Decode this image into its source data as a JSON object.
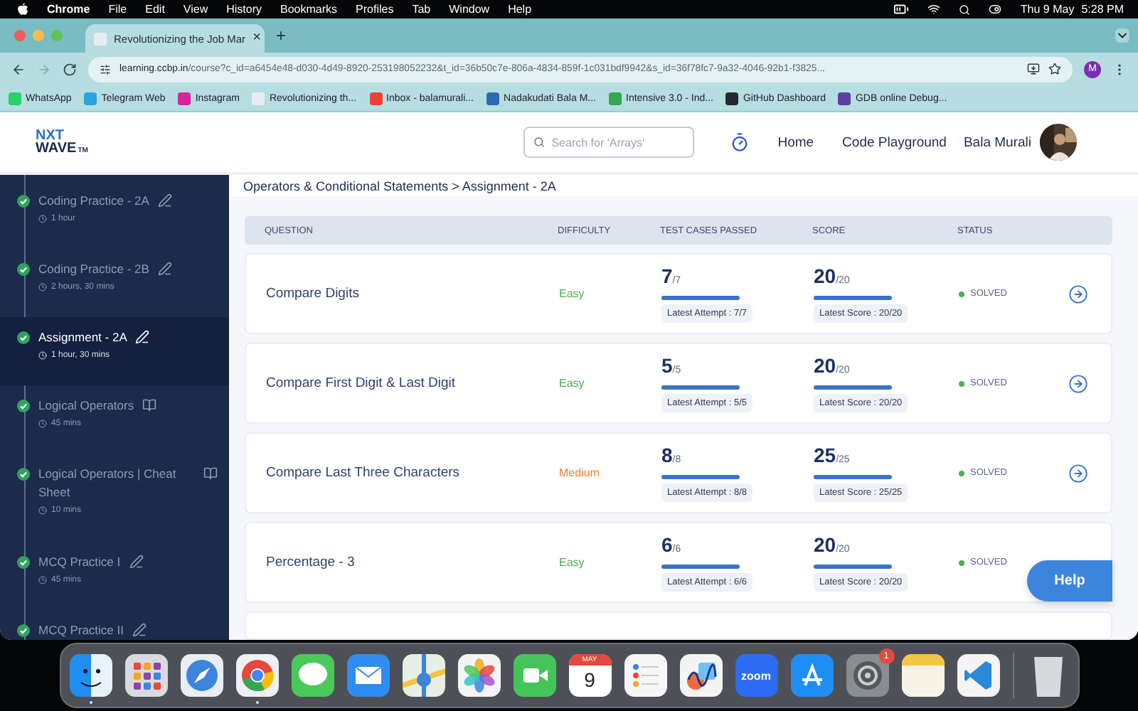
{
  "menu_bar": {
    "app": "Chrome",
    "items": [
      "File",
      "Edit",
      "View",
      "History",
      "Bookmarks",
      "Profiles",
      "Tab",
      "Window",
      "Help"
    ],
    "date": "Thu 9 May",
    "time": "5:28 PM"
  },
  "browser": {
    "tab": {
      "title": "Revolutionizing the Job Mar",
      "close": "×"
    },
    "new_tab": "+",
    "url": {
      "host": "learning.ccbp.in",
      "path": "/course?c_id=a6454e48-d030-4d49-8920-253198052232&t_id=36b50c7e-806a-4834-859f-1c031bdf9942&s_id=36f78fc7-9a32-4046-92b1-f3825..."
    },
    "profile": "M",
    "bookmarks": [
      {
        "label": "WhatsApp",
        "color": "#25d366"
      },
      {
        "label": "Telegram Web",
        "color": "#2aa3df"
      },
      {
        "label": "Instagram",
        "color": "#d6249f"
      },
      {
        "label": "Revolutionizing th...",
        "color": "#e8ecf2"
      },
      {
        "label": "Inbox - balamurali...",
        "color": "#ea4335"
      },
      {
        "label": "Nadakudati Bala M...",
        "color": "#2d6ab4"
      },
      {
        "label": "Intensive 3.0 - Ind...",
        "color": "#34a853"
      },
      {
        "label": "GitHub Dashboard",
        "color": "#24292e"
      },
      {
        "label": "GDB online Debug...",
        "color": "#5b3fa3"
      }
    ]
  },
  "header": {
    "logo": {
      "top": "NXT",
      "bottom": "WAVE",
      "mark": "TM"
    },
    "search": {
      "placeholder": "Search for 'Arrays'"
    },
    "nav": [
      "Home",
      "Code Playground"
    ],
    "user": "Bala Murali"
  },
  "sidebar": {
    "items": [
      {
        "title": "Coding Practice - 2A",
        "duration": "1 hour",
        "kind": "edit",
        "completed": true,
        "selected": false
      },
      {
        "title": "Coding Practice - 2B",
        "duration": "2 hours, 30 mins",
        "kind": "edit",
        "completed": true,
        "selected": false
      },
      {
        "title": "Assignment - 2A",
        "duration": "1 hour, 30 mins",
        "kind": "edit",
        "completed": true,
        "selected": true
      },
      {
        "title": "Logical Operators",
        "duration": "45 mins",
        "kind": "book",
        "completed": true,
        "selected": false
      },
      {
        "title": "Logical Operators | Cheat Sheet",
        "duration": "10 mins",
        "kind": "book",
        "completed": true,
        "selected": false
      },
      {
        "title": "MCQ Practice I",
        "duration": "45 mins",
        "kind": "edit",
        "completed": true,
        "selected": false
      },
      {
        "title": "MCQ Practice II",
        "kind": "edit",
        "completed": true,
        "selected": false
      }
    ]
  },
  "breadcrumb": "Operators & Conditional Statements > Assignment - 2A",
  "table": {
    "columns": [
      "QUESTION",
      "DIFFICULTY",
      "TEST CASES PASSED",
      "SCORE",
      "STATUS"
    ],
    "rows": [
      {
        "question": "Compare Digits",
        "difficulty": {
          "label": "Easy",
          "color": "#4caf50"
        },
        "tests": {
          "value": "7",
          "total": "/7",
          "level": 1,
          "latest": "Latest Attempt : 7/7"
        },
        "score": {
          "value": "20",
          "total": "/20",
          "level": 1,
          "latest": "Latest Score : 20/20"
        },
        "status": {
          "label": "SOLVED",
          "color": "#4caf50"
        },
        "arrow": true
      },
      {
        "question": "Compare First Digit & Last Digit",
        "difficulty": {
          "label": "Easy",
          "color": "#4caf50"
        },
        "tests": {
          "value": "5",
          "total": "/5",
          "level": 1,
          "latest": "Latest Attempt : 5/5"
        },
        "score": {
          "value": "20",
          "total": "/20",
          "level": 1,
          "latest": "Latest Score : 20/20"
        },
        "status": {
          "label": "SOLVED",
          "color": "#4caf50"
        },
        "arrow": true
      },
      {
        "question": "Compare Last Three Characters",
        "difficulty": {
          "label": "Medium",
          "color": "#e8802f"
        },
        "tests": {
          "value": "8",
          "total": "/8",
          "level": 1,
          "latest": "Latest Attempt : 8/8"
        },
        "score": {
          "value": "25",
          "total": "/25",
          "level": 1,
          "latest": "Latest Score : 25/25"
        },
        "status": {
          "label": "SOLVED",
          "color": "#4caf50"
        },
        "arrow": true
      },
      {
        "question": "Percentage - 3",
        "difficulty": {
          "label": "Easy",
          "color": "#4caf50"
        },
        "tests": {
          "value": "6",
          "total": "/6",
          "level": 1,
          "latest": "Latest Attempt : 6/6"
        },
        "score": {
          "value": "20",
          "total": "/20",
          "level": 1,
          "latest": "Latest Score : 20/20"
        },
        "status": {
          "label": "SOLVED",
          "color": "#4caf50"
        },
        "arrow": false
      }
    ]
  },
  "help": "Help",
  "dock": [
    {
      "kind": "finder",
      "running": true
    },
    {
      "kind": "launchpad",
      "running": false
    },
    {
      "kind": "safari",
      "running": false
    },
    {
      "kind": "chrome",
      "running": true
    },
    {
      "kind": "messages",
      "running": false
    },
    {
      "kind": "mail",
      "running": false
    },
    {
      "kind": "maps",
      "running": false
    },
    {
      "kind": "photos",
      "running": false
    },
    {
      "kind": "facetime",
      "running": false
    },
    {
      "kind": "calendar",
      "month": "MAY",
      "day": "9",
      "running": false
    },
    {
      "kind": "reminders",
      "running": false
    },
    {
      "kind": "freeform",
      "running": false
    },
    {
      "kind": "zoom",
      "label": "zoom",
      "running": false
    },
    {
      "kind": "appstore",
      "running": false
    },
    {
      "kind": "settings",
      "badge": "1",
      "running": false
    },
    {
      "kind": "notes",
      "running": false
    },
    {
      "kind": "vscode",
      "running": false
    },
    {
      "kind": "trash",
      "running": false
    }
  ]
}
